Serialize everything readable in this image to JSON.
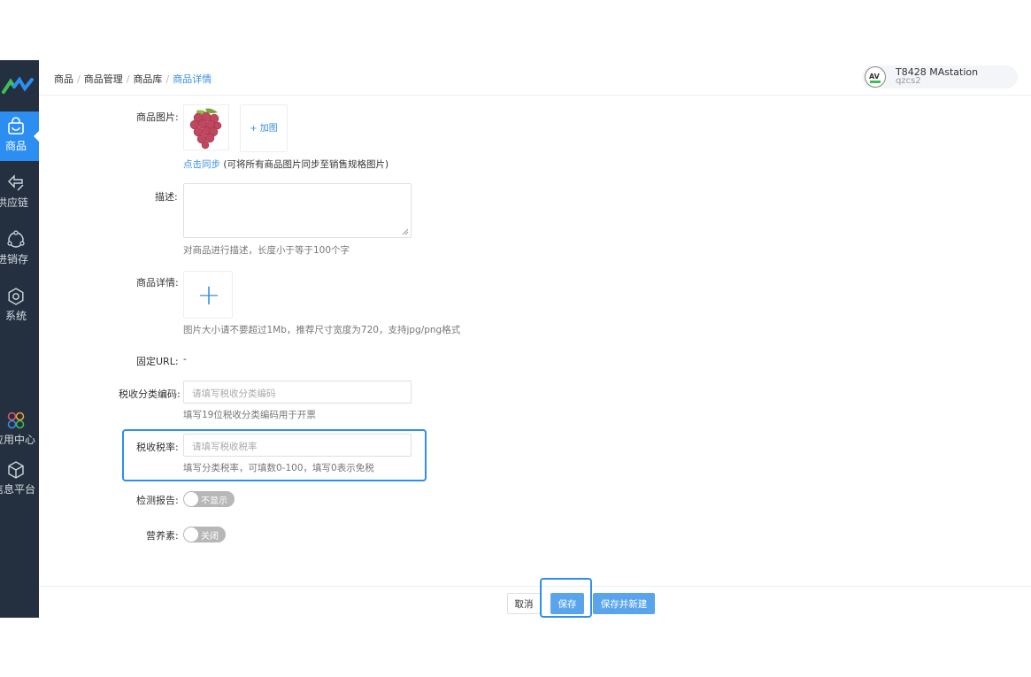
{
  "sidebar": {
    "items": [
      {
        "label": "商品",
        "icon": "shopping-bag-icon",
        "active": true
      },
      {
        "label": "供应链",
        "icon": "exchange-arrows-icon",
        "active": false
      },
      {
        "label": "进销存",
        "icon": "cube-network-icon",
        "active": false
      },
      {
        "label": "系统",
        "icon": "gear-icon",
        "active": false
      },
      {
        "label": "应用中心",
        "icon": "app-grid-icon",
        "active": false
      },
      {
        "label": "信息平台",
        "icon": "box-icon",
        "active": false
      }
    ]
  },
  "header": {
    "breadcrumb": [
      "商品",
      "商品管理",
      "商品库",
      "商品详情"
    ],
    "user": {
      "name": "T8428 MAstation",
      "account": "qzcs2",
      "avatar_text": "AV"
    }
  },
  "form": {
    "image": {
      "label": "商品图片:",
      "add_label": "+ 加图",
      "sync_link": "点击同步",
      "sync_note": "(可将所有商品图片同步至销售规格图片)"
    },
    "description": {
      "label": "描述:",
      "hint": "对商品进行描述，长度小于等于100个字"
    },
    "detail": {
      "label": "商品详情:",
      "hint": "图片大小请不要超过1Mb，推荐尺寸宽度为720，支持jpg/png格式"
    },
    "fixed_url": {
      "label": "固定URL:",
      "value": "-"
    },
    "tax_code": {
      "label": "税收分类编码:",
      "placeholder": "请填写税收分类编码",
      "hint": "填写19位税收分类编码用于开票"
    },
    "tax_rate": {
      "label": "税收税率:",
      "placeholder": "请填写税收税率",
      "hint": "填写分类税率，可填数0-100，填写0表示免税"
    },
    "test_report": {
      "label": "检测报告:",
      "toggle_text": "不显示"
    },
    "nutrition": {
      "label": "营养素:",
      "toggle_text": "关闭"
    }
  },
  "footer": {
    "cancel": "取消",
    "save": "保存",
    "save_new": "保存并新建"
  },
  "colors": {
    "sidebar": "#24303f",
    "accent": "#2b8ef0",
    "link": "#3a8ee6",
    "button": "#5aa4ec"
  }
}
